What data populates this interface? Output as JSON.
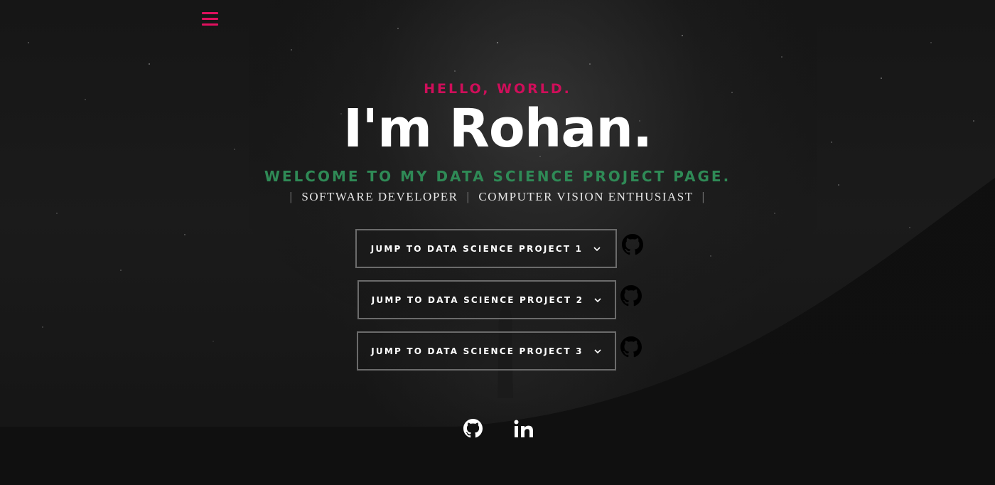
{
  "nav": {
    "menu_icon": "hamburger-menu-icon",
    "accent_color": "#e0105e"
  },
  "hero": {
    "greeting": "HELLO, WORLD.",
    "name": "I'm Rohan.",
    "welcome": "WELCOME TO MY DATA SCIENCE PROJECT PAGE.",
    "roles": [
      "SOFTWARE DEVELOPER",
      "COMPUTER VISION ENTHUSIAST"
    ],
    "separator": "|",
    "colors": {
      "greeting": "#cf0e5a",
      "name": "#ffffff",
      "welcome": "#2f8a56",
      "background": "#121212"
    }
  },
  "projects": [
    {
      "label": "JUMP TO DATA SCIENCE PROJECT 1",
      "icon": "chevron-down-icon",
      "repo_icon": "github-icon"
    },
    {
      "label": "JUMP TO DATA SCIENCE PROJECT 2",
      "icon": "chevron-down-icon",
      "repo_icon": "github-icon"
    },
    {
      "label": "JUMP TO DATA SCIENCE PROJECT 3",
      "icon": "chevron-down-icon",
      "repo_icon": "github-icon"
    }
  ],
  "social": [
    {
      "name": "github",
      "icon": "github-icon"
    },
    {
      "name": "linkedin",
      "icon": "linkedin-icon",
      "text": "in"
    }
  ]
}
